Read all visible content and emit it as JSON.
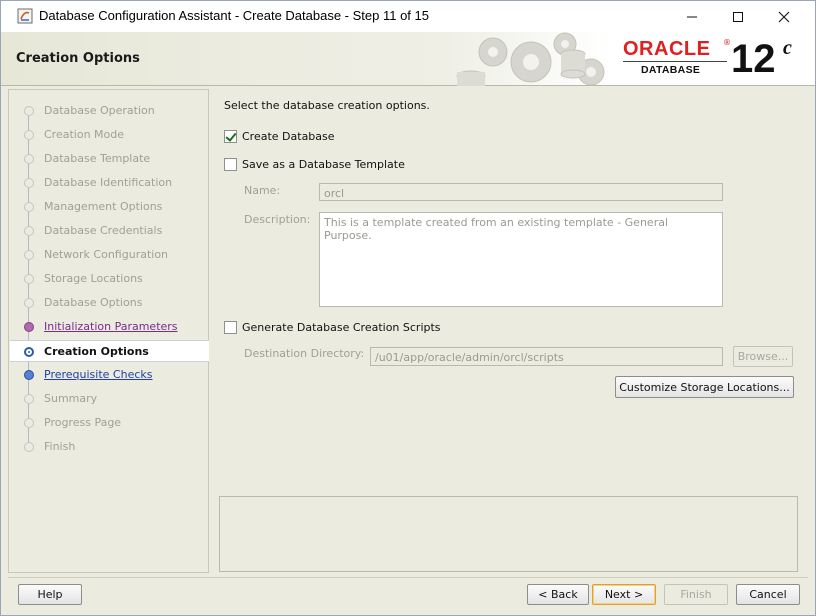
{
  "window": {
    "title": "Database Configuration Assistant - Create Database - Step 11 of 15"
  },
  "banner": {
    "page_title": "Creation Options",
    "logo": {
      "brand": "ORACLE",
      "registered": "®",
      "product": "DATABASE",
      "version": "12",
      "version_suffix": "c"
    }
  },
  "nav": {
    "items": [
      {
        "label": "Database Operation",
        "state": "disabled"
      },
      {
        "label": "Creation Mode",
        "state": "disabled"
      },
      {
        "label": "Database Template",
        "state": "disabled"
      },
      {
        "label": "Database Identification",
        "state": "disabled"
      },
      {
        "label": "Management Options",
        "state": "disabled"
      },
      {
        "label": "Database Credentials",
        "state": "disabled"
      },
      {
        "label": "Network Configuration",
        "state": "disabled"
      },
      {
        "label": "Storage Locations",
        "state": "disabled"
      },
      {
        "label": "Database Options",
        "state": "disabled"
      },
      {
        "label": "Initialization Parameters",
        "state": "done"
      },
      {
        "label": "Creation Options",
        "state": "current"
      },
      {
        "label": "Prerequisite Checks",
        "state": "next"
      },
      {
        "label": "Summary",
        "state": "disabled"
      },
      {
        "label": "Progress Page",
        "state": "disabled"
      },
      {
        "label": "Finish",
        "state": "disabled"
      }
    ]
  },
  "content": {
    "intro": "Select the database creation options.",
    "create_database": {
      "label": "Create Database",
      "checked": true
    },
    "save_template": {
      "label": "Save as a Database Template",
      "checked": false
    },
    "name_label": "Name:",
    "name_value": "orcl",
    "description_label": "Description:",
    "description_value": "This is a template created from an existing template - General Purpose.",
    "generate_scripts": {
      "label": "Generate Database Creation Scripts",
      "checked": false
    },
    "destination_label": "Destination Directory:",
    "destination_value": "/u01/app/oracle/admin/orcl/scripts",
    "browse_label": "Browse...",
    "customize_label": "Customize Storage Locations..."
  },
  "footer": {
    "help": "Help",
    "back": "< Back",
    "next": "Next >",
    "finish": "Finish",
    "cancel": "Cancel"
  },
  "colors": {
    "background": "#ebebdf",
    "oracle_red": "#e02020",
    "link_done": "#7a2a8a",
    "link_next": "#1f3fa8"
  }
}
